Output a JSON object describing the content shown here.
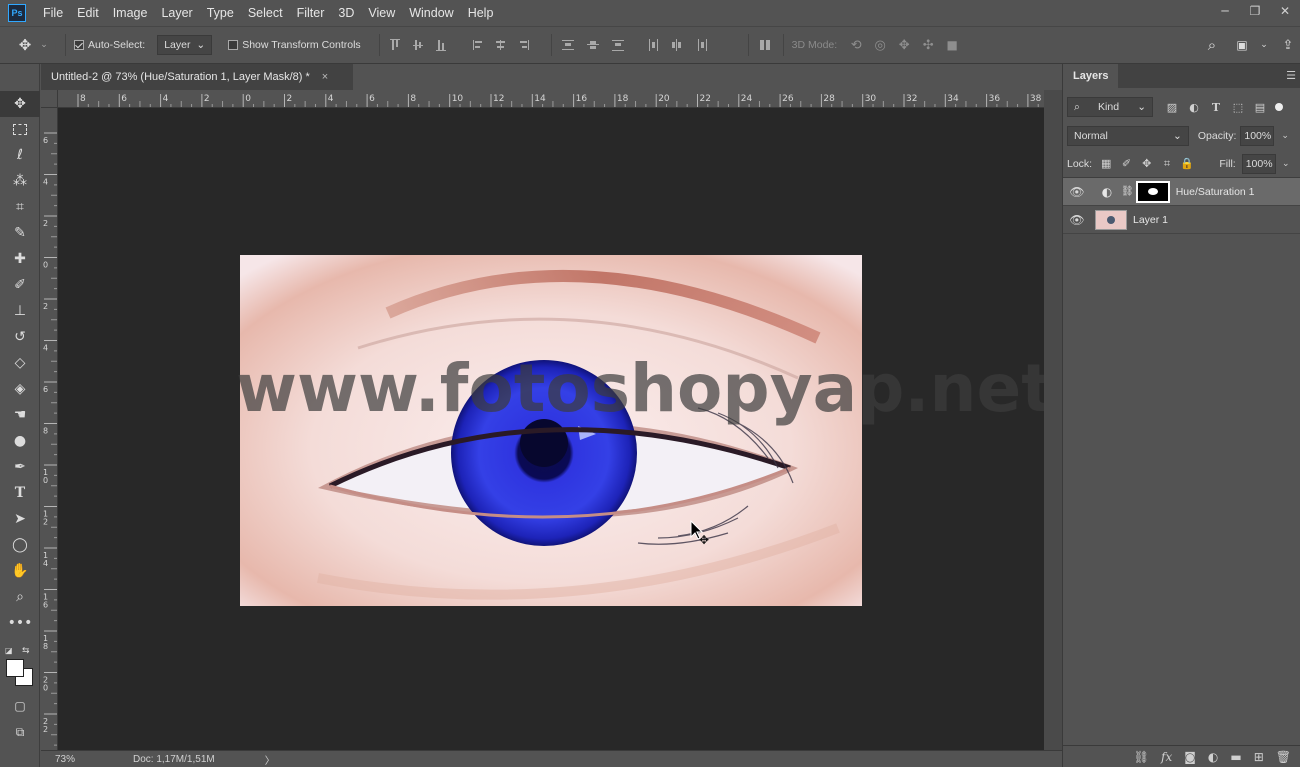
{
  "app": {
    "logo": "Ps"
  },
  "menu": [
    "File",
    "Edit",
    "Image",
    "Layer",
    "Type",
    "Select",
    "Filter",
    "3D",
    "View",
    "Window",
    "Help"
  ],
  "window_controls": [
    "─",
    "❐",
    "✕"
  ],
  "options": {
    "auto_select_label": "Auto-Select:",
    "auto_select_value": "Layer",
    "transform_label": "Show Transform Controls",
    "mode_3d_label": "3D Mode:"
  },
  "document": {
    "tab_title": "Untitled-2 @ 73% (Hue/Saturation 1, Layer Mask/8) *",
    "close": "×",
    "watermark": "www.fotoshopyap.net"
  },
  "ruler": {
    "top_labels": [
      "8",
      "6",
      "4",
      "2",
      "0",
      "2",
      "4",
      "6",
      "8",
      "10",
      "12",
      "14",
      "16",
      "18",
      "20",
      "22",
      "24",
      "26",
      "28",
      "30",
      "32",
      "34",
      "36",
      "38"
    ],
    "left_labels": [
      "6",
      "4",
      "2",
      "0",
      "2",
      "4",
      "6",
      "8",
      "1 0",
      "1 2",
      "1 4",
      "1 6",
      "1 8",
      "2 0",
      "2 2"
    ]
  },
  "status": {
    "zoom": "73%",
    "doc": "Doc: 1,17M/1,51M",
    "arrow": "〉"
  },
  "layers_panel": {
    "tab": "Layers",
    "filter_label": "Kind",
    "blend_mode": "Normal",
    "opacity_label": "Opacity:",
    "opacity_value": "100%",
    "lock_label": "Lock:",
    "fill_label": "Fill:",
    "fill_value": "100%",
    "layers": [
      {
        "name": "Hue/Saturation 1",
        "selected": true
      },
      {
        "name": "Layer 1",
        "selected": false
      }
    ]
  }
}
